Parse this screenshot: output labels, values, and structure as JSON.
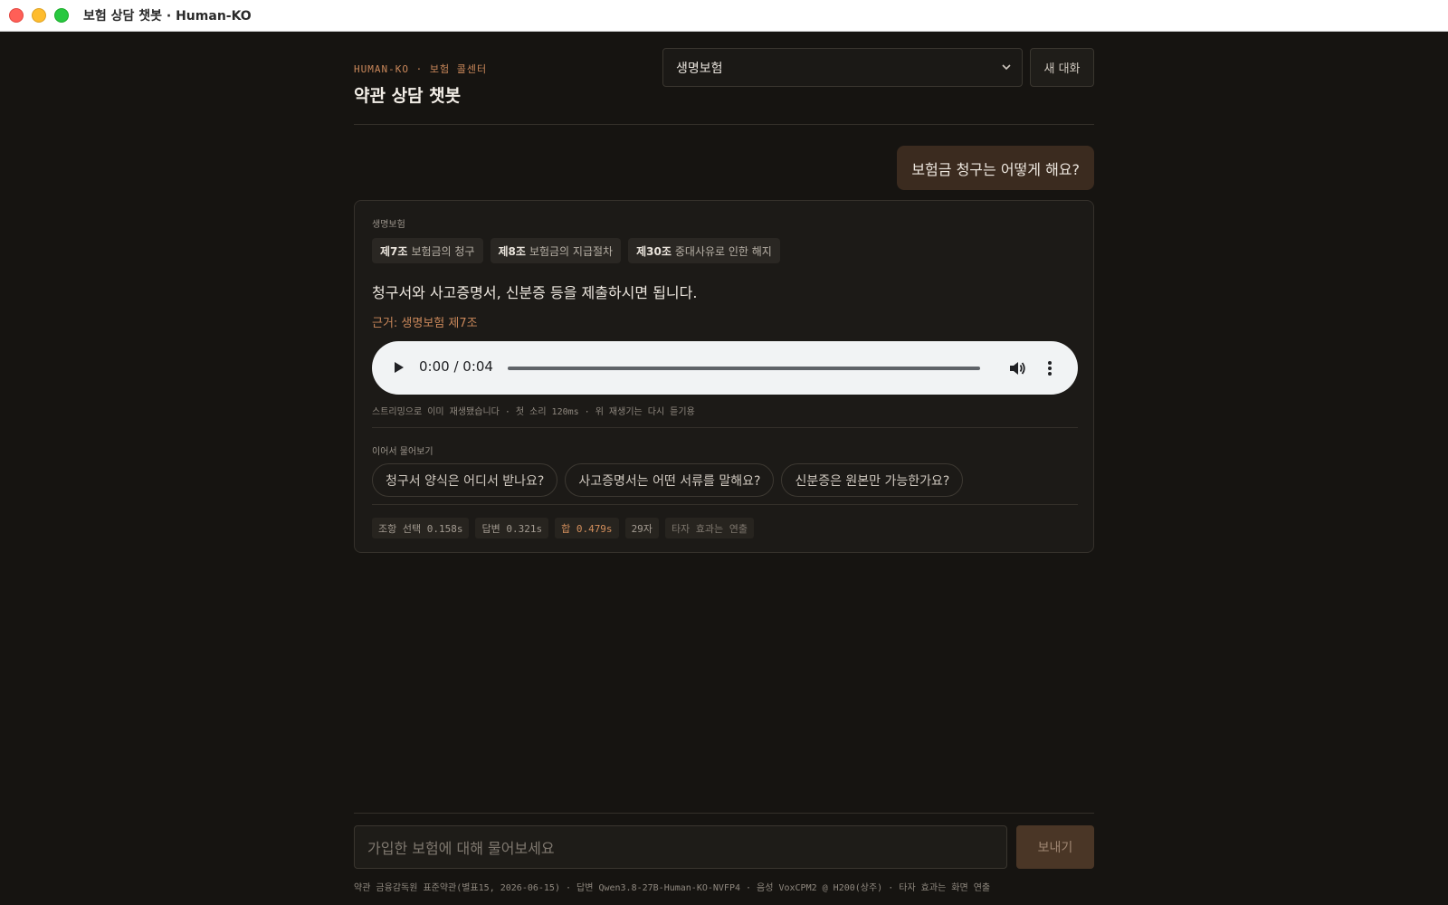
{
  "window": {
    "title": "보험 상담 챗봇 · Human-KO"
  },
  "header": {
    "brand": "HUMAN-KO · 보험 콜센터",
    "title": "약관 상담 챗봇",
    "product_select": "생명보험",
    "new_chat_label": "새 대화"
  },
  "conversation": {
    "user_message": "보험금 청구는 어떻게 해요?",
    "answer": {
      "product": "생명보험",
      "clauses": [
        {
          "number": "제7조",
          "title": "보험금의 청구"
        },
        {
          "number": "제8조",
          "title": "보험금의 지급절차"
        },
        {
          "number": "제30조",
          "title": "중대사유로 인한 해지"
        }
      ],
      "text": "청구서와 사고증명서, 신분증 등을 제출하시면 됩니다.",
      "evidence": "근거: 생명보험 제7조",
      "audio": {
        "time": "0:00 / 0:04"
      },
      "stream_note": "스트리밍으로 이미 재생됐습니다 · 첫 소리 120ms · 위 재생기는 다시 듣기용",
      "follow_label": "이어서 물어보기",
      "follow_ups": [
        "청구서 양식은 어디서 받나요?",
        "사고증명서는 어떤 서류를 말해요?",
        "신분증은 원본만 가능한가요?"
      ],
      "metrics": {
        "select": "조항 선택 0.158s",
        "answer": "답변 0.321s",
        "total": "합 0.479s",
        "chars": "29자",
        "note": "타자 효과는 연출"
      }
    }
  },
  "composer": {
    "placeholder": "가입한 보험에 대해 물어보세요",
    "send_label": "보내기"
  },
  "footer": "약관 금융감독원 표준약관(별표15, 2026-06-15) · 답변 Qwen3.8-27B-Human-KO-NVFP4 · 음성 VoxCPM2 @ H200(상주) · 타자 효과는 화면 연출",
  "colors": {
    "accent": "#c9875a",
    "background": "#161411",
    "user_bubble": "#3b2b1f",
    "send": "#4a3626"
  },
  "icons": [
    "chevron-down-icon",
    "play-icon",
    "volume-icon",
    "more-vert-icon"
  ]
}
